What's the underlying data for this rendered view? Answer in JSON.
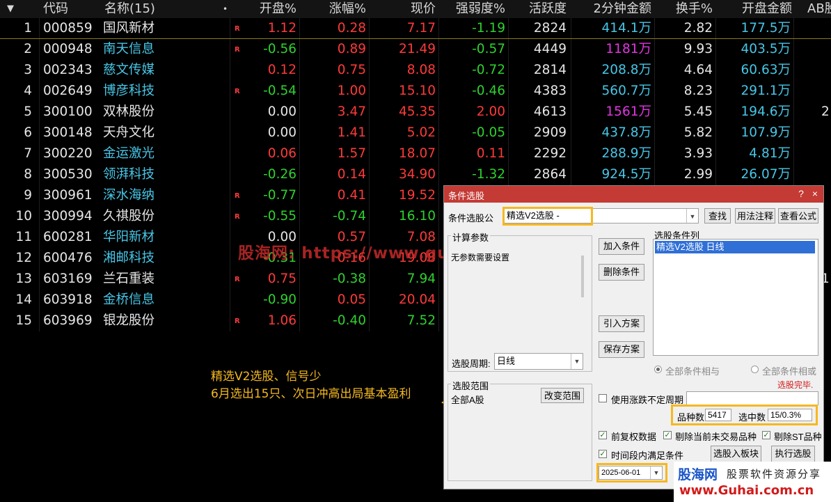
{
  "table": {
    "headers": {
      "sort": "▼",
      "code": "代码",
      "name": "名称(15)",
      "name_dot": "•",
      "open_pct": "开盘%",
      "change_pct": "涨幅%",
      "price": "现价",
      "strength_pct": "强弱度%",
      "activity": "活跃度",
      "amount_2min": "2分钟金额",
      "turnover_pct": "换手%",
      "open_amount": "开盘金额",
      "ab": "AB股"
    },
    "r_mark": "R",
    "rows": [
      {
        "no": "1",
        "code": "000859",
        "name": "国风新材",
        "r": true,
        "open": "1.12",
        "chg": "0.28",
        "price": "7.17",
        "strength": "-1.19",
        "activity": "2824",
        "amt2": "414.1万",
        "turnover": "2.82",
        "openamt": "177.5万",
        "ab": ""
      },
      {
        "no": "2",
        "code": "000948",
        "name": "南天信息",
        "r": true,
        "open": "-0.56",
        "chg": "0.89",
        "price": "21.49",
        "strength": "-0.57",
        "activity": "4449",
        "amt2": "1181万",
        "turnover": "9.93",
        "openamt": "403.5万",
        "ab": ""
      },
      {
        "no": "3",
        "code": "002343",
        "name": "慈文传媒",
        "r": false,
        "open": "0.12",
        "chg": "0.75",
        "price": "8.08",
        "strength": "-0.72",
        "activity": "2814",
        "amt2": "208.8万",
        "turnover": "4.64",
        "openamt": "60.63万",
        "ab": ""
      },
      {
        "no": "4",
        "code": "002649",
        "name": "博彦科技",
        "r": true,
        "open": "-0.54",
        "chg": "1.00",
        "price": "15.10",
        "strength": "-0.46",
        "activity": "4383",
        "amt2": "560.7万",
        "turnover": "8.23",
        "openamt": "291.1万",
        "ab": ""
      },
      {
        "no": "5",
        "code": "300100",
        "name": "双林股份",
        "r": false,
        "open": "0.00",
        "chg": "3.47",
        "price": "45.35",
        "strength": "2.00",
        "activity": "4613",
        "amt2": "1561万",
        "turnover": "5.45",
        "openamt": "194.6万",
        "ab": "2"
      },
      {
        "no": "6",
        "code": "300148",
        "name": "天舟文化",
        "r": false,
        "open": "0.00",
        "chg": "1.41",
        "price": "5.02",
        "strength": "-0.05",
        "activity": "2909",
        "amt2": "437.8万",
        "turnover": "5.82",
        "openamt": "107.9万",
        "ab": ""
      },
      {
        "no": "7",
        "code": "300220",
        "name": "金运激光",
        "r": false,
        "open": "0.06",
        "chg": "1.57",
        "price": "18.07",
        "strength": "0.11",
        "activity": "2292",
        "amt2": "288.9万",
        "turnover": "3.93",
        "openamt": "4.81万",
        "ab": ""
      },
      {
        "no": "8",
        "code": "300530",
        "name": "领湃科技",
        "r": false,
        "open": "-0.26",
        "chg": "0.14",
        "price": "34.90",
        "strength": "-1.32",
        "activity": "2864",
        "amt2": "924.5万",
        "turnover": "2.99",
        "openamt": "26.07万",
        "ab": ""
      },
      {
        "no": "9",
        "code": "300961",
        "name": "深水海纳",
        "r": true,
        "open": "-0.77",
        "chg": "0.41",
        "price": "19.52",
        "strength": "",
        "activity": "",
        "amt2": "",
        "turnover": "",
        "openamt": "",
        "ab": ""
      },
      {
        "no": "10",
        "code": "300994",
        "name": "久祺股份",
        "r": true,
        "open": "-0.55",
        "chg": "-0.74",
        "price": "16.10",
        "strength": "",
        "activity": "",
        "amt2": "",
        "turnover": "",
        "openamt": "",
        "ab": ""
      },
      {
        "no": "11",
        "code": "600281",
        "name": "华阳新材",
        "r": false,
        "open": "0.00",
        "chg": "0.57",
        "price": "7.08",
        "strength": "",
        "activity": "",
        "amt2": "",
        "turnover": "",
        "openamt": "",
        "ab": ""
      },
      {
        "no": "12",
        "code": "600476",
        "name": "湘邮科技",
        "r": false,
        "open": "-0.31",
        "chg": "0.16",
        "price": "19.08",
        "strength": "",
        "activity": "",
        "amt2": "",
        "turnover": "",
        "openamt": "",
        "ab": ""
      },
      {
        "no": "13",
        "code": "603169",
        "name": "兰石重装",
        "r": true,
        "open": "0.75",
        "chg": "-0.38",
        "price": "7.94",
        "strength": "",
        "activity": "",
        "amt2": "",
        "turnover": "",
        "openamt": "",
        "ab": "1"
      },
      {
        "no": "14",
        "code": "603918",
        "name": "金桥信息",
        "r": false,
        "open": "-0.90",
        "chg": "0.05",
        "price": "20.04",
        "strength": "",
        "activity": "",
        "amt2": "",
        "turnover": "",
        "openamt": "",
        "ab": ""
      },
      {
        "no": "15",
        "code": "603969",
        "name": "银龙股份",
        "r": true,
        "open": "1.06",
        "chg": "-0.40",
        "price": "7.52",
        "strength": "",
        "activity": "",
        "amt2": "",
        "turnover": "",
        "openamt": "",
        "ab": ""
      }
    ]
  },
  "dialog": {
    "title": "条件选股",
    "help_btn": "?",
    "close_btn": "×",
    "formula_label": "条件选股公",
    "formula_value": "精选V2选股  -",
    "find_btn": "查找",
    "usage_btn": "用法注释",
    "view_formula_btn": "查看公式",
    "params_group": "计算参数",
    "params_text": "无参数需要设置",
    "add_condition_btn": "加入条件",
    "delete_condition_btn": "删除条件",
    "import_plan_btn": "引入方案",
    "save_plan_btn": "保存方案",
    "condition_list_label": "选股条件列",
    "condition_item": "精选V2选股  日线",
    "period_label": "选股周期:",
    "period_value": "日线",
    "radio_and": "全部条件相与",
    "radio_or": "全部条件相或",
    "status": "选股完毕.",
    "scope_group": "选股范围",
    "change_scope_btn": "改变范围",
    "scope_value": "全部A股",
    "use_limit_label": "使用涨跌不定周期",
    "variety_label": "品种数",
    "variety_value": "5417",
    "selected_label": "选中数",
    "selected_value": "15/0.3%",
    "fq_label": "前复权数据",
    "exclude_untraded_label": "剔除当前未交易品种",
    "exclude_st_label": "剔除ST品种",
    "period_satisfy_label": "时间段内满足条件",
    "to_block_btn": "选股入板块",
    "execute_btn": "执行选股",
    "date_value": "2025-06-01",
    "checked_mark": "✓"
  },
  "annotation": {
    "line1": "精选V2选股、信号少",
    "line2": "6月选出15只、次日冲高出局基本盈利"
  },
  "watermark": "股海网: https://www.guhai.com.cn",
  "logo": {
    "brand": "股海网",
    "slogan": "股票软件资源分享",
    "url": "www.Guhai.com.cn"
  },
  "colors": {
    "up": "#ff3a3a",
    "down": "#2ed12e",
    "flat": "#e6e6e6",
    "cyan": "#47c6e6",
    "magenta": "#e236e2",
    "accent": "#f5b820",
    "title_bar": "#c43a34"
  }
}
